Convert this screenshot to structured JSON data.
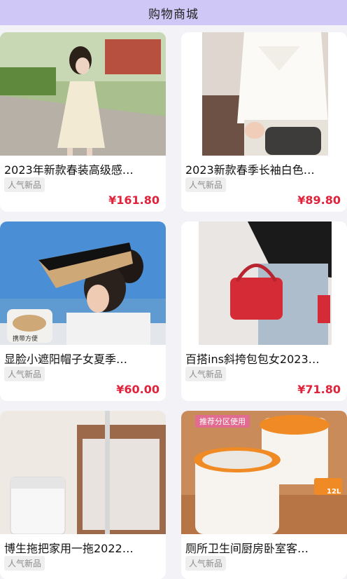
{
  "header": {
    "title": "购物商城"
  },
  "products": [
    {
      "name": "2023年新款春装高级感…",
      "tag": "人气新品",
      "price": "¥161.80"
    },
    {
      "name": "2023新款春季长袖白色…",
      "tag": "人气新品",
      "price": "¥89.80"
    },
    {
      "name": "显脸小遮阳帽子女夏季…",
      "tag": "人气新品",
      "price": "¥60.00",
      "image_text": "携带方便"
    },
    {
      "name": "百搭ins斜挎包包女2023…",
      "tag": "人气新品",
      "price": "¥71.80"
    },
    {
      "name": "博生拖把家用一拖2022…",
      "tag": "人气新品",
      "price": ""
    },
    {
      "name": "厕所卫生间厨房卧室客…",
      "tag": "人气新品",
      "price": "",
      "image_text": "推荐分区使用",
      "image_badge": "12L"
    }
  ],
  "colors": {
    "header_bg": "#cfc7f6",
    "price": "#e0223b",
    "tag_bg": "#f0eff0"
  }
}
